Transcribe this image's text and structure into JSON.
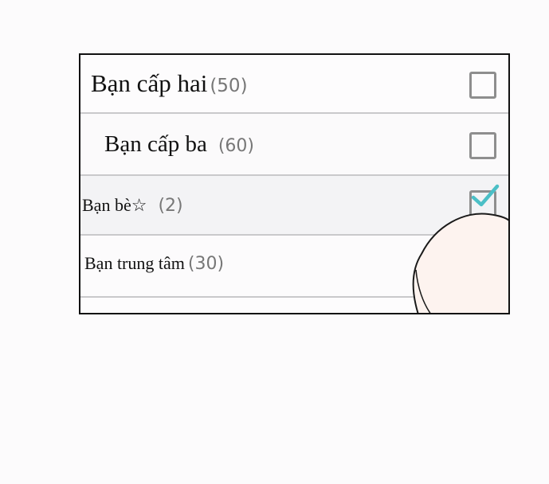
{
  "groups": [
    {
      "name": "Bạn cấp hai",
      "count": "(50)",
      "checked": false
    },
    {
      "name": "Bạn cấp ba",
      "count": "(60)",
      "checked": false
    },
    {
      "name": "Bạn bè☆",
      "count": "(2)",
      "checked": true
    },
    {
      "name": "Bạn trung tâm",
      "count": "(30)",
      "checked": false
    }
  ],
  "colors": {
    "check_accent": "#4bbfc6",
    "checkbox_border": "#8e8e8e",
    "count_text": "#777777",
    "divider": "#c9c9cb",
    "frame_border": "#111111"
  },
  "icons": [
    "checkbox-icon",
    "checkmark-icon",
    "finger-icon"
  ]
}
